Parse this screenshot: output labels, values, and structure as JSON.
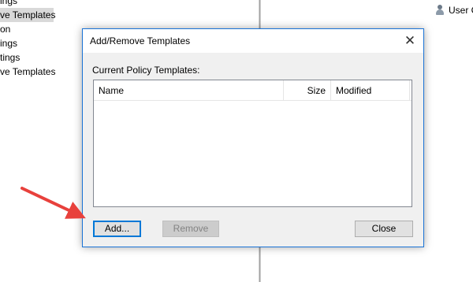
{
  "background": {
    "tree_items": [
      {
        "label": "ings",
        "selected": false
      },
      {
        "label": "ve Templates",
        "selected": true
      },
      {
        "label": "on",
        "selected": false
      },
      {
        "label": "ings",
        "selected": false
      },
      {
        "label": "tings",
        "selected": false
      },
      {
        "label": "ve Templates",
        "selected": false
      }
    ],
    "right_header": {
      "label": "User C",
      "icon": "user-icon"
    }
  },
  "dialog": {
    "title": "Add/Remove Templates",
    "close_glyph": "✕",
    "section_label": "Current Policy Templates:",
    "columns": [
      "Name",
      "Size",
      "Modified"
    ],
    "rows": [],
    "buttons": {
      "add": "Add...",
      "remove": "Remove",
      "close": "Close"
    }
  },
  "colors": {
    "accent": "#0078d7",
    "annotation_arrow": "#e8413c"
  }
}
